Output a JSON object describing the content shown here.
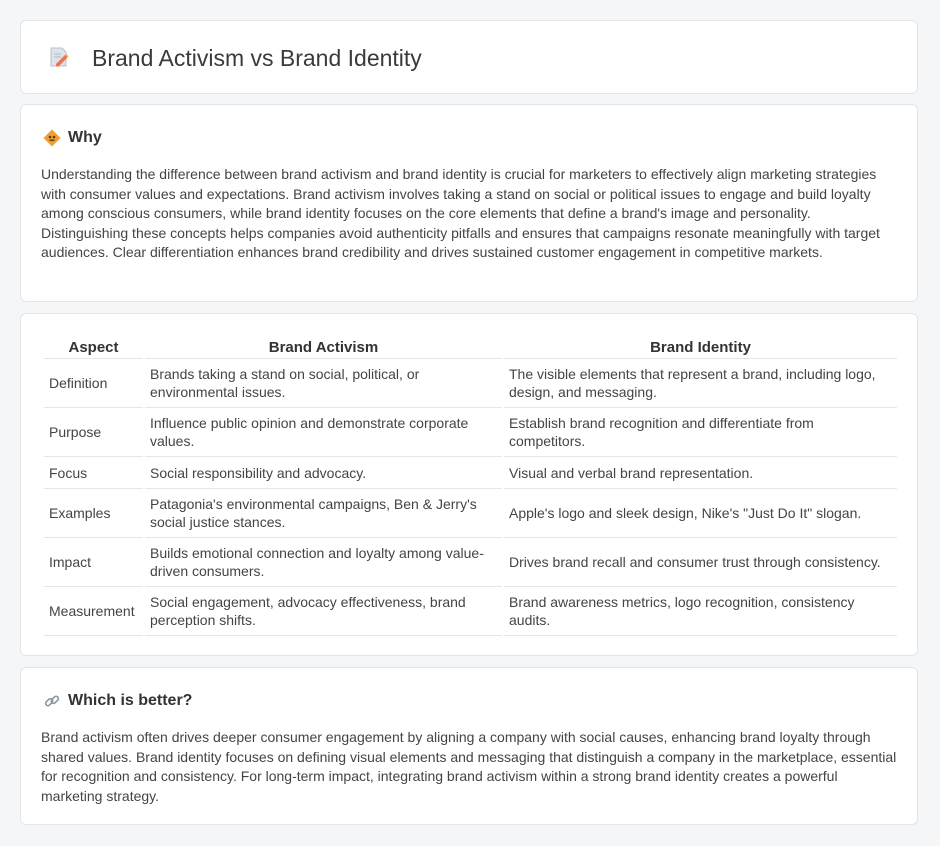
{
  "header": {
    "title": "Brand Activism vs Brand Identity",
    "icon": "document-pencil-icon"
  },
  "why": {
    "heading": "Why",
    "icon": "diamond-sign-icon",
    "body": "Understanding the difference between brand activism and brand identity is crucial for marketers to effectively align marketing strategies with consumer values and expectations. Brand activism involves taking a stand on social or political issues to engage and build loyalty among conscious consumers, while brand identity focuses on the core elements that define a brand's image and personality. Distinguishing these concepts helps companies avoid authenticity pitfalls and ensures that campaigns resonate meaningfully with target audiences. Clear differentiation enhances brand credibility and drives sustained customer engagement in competitive markets."
  },
  "table": {
    "headers": [
      "Aspect",
      "Brand Activism",
      "Brand Identity"
    ],
    "rows": [
      [
        "Definition",
        "Brands taking a stand on social, political, or environmental issues.",
        "The visible elements that represent a brand, including logo, design, and messaging."
      ],
      [
        "Purpose",
        "Influence public opinion and demonstrate corporate values.",
        "Establish brand recognition and differentiate from competitors."
      ],
      [
        "Focus",
        "Social responsibility and advocacy.",
        "Visual and verbal brand representation."
      ],
      [
        "Examples",
        "Patagonia's environmental campaigns, Ben & Jerry's social justice stances.",
        "Apple's logo and sleek design, Nike's \"Just Do It\" slogan."
      ],
      [
        "Impact",
        "Builds emotional connection and loyalty among value-driven consumers.",
        "Drives brand recall and consumer trust through consistency."
      ],
      [
        "Measurement",
        "Social engagement, advocacy effectiveness, brand perception shifts.",
        "Brand awareness metrics, logo recognition, consistency audits."
      ]
    ]
  },
  "better": {
    "heading": "Which is better?",
    "icon": "link-icon",
    "body": "Brand activism often drives deeper consumer engagement by aligning a company with social causes, enhancing brand loyalty through shared values. Brand identity focuses on defining visual elements and messaging that distinguish a company in the marketplace, essential for recognition and consistency. For long-term impact, integrating brand activism within a strong brand identity creates a powerful marketing strategy."
  },
  "colors": {
    "background": "#f5f6f8",
    "card": "#ffffff",
    "border": "#e2e5ea",
    "accent_orange": "#f0a030"
  }
}
